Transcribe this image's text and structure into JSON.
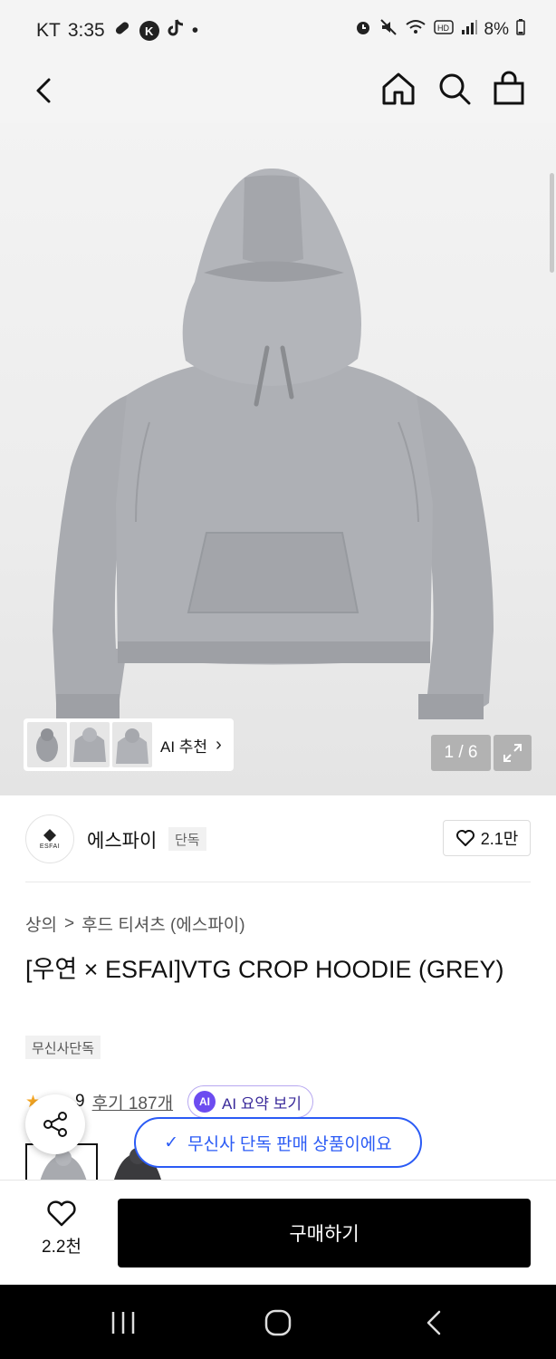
{
  "status_bar": {
    "carrier": "KT",
    "time": "3:35",
    "left_icons": [
      "link-icon",
      "k-app-icon",
      "tiktok-icon",
      "dot-icon"
    ],
    "right_icons": [
      "alarm-icon",
      "mute-icon",
      "wifi-icon",
      "hd-icon",
      "signal-icon"
    ],
    "battery": "8%"
  },
  "header": {
    "icons": [
      "back-arrow-icon",
      "home-icon",
      "search-icon",
      "shopping-bag-icon"
    ]
  },
  "gallery": {
    "ai_recommend_label": "AI 추천",
    "page_counter": "1 / 6",
    "current_page": 1,
    "total_pages": 6
  },
  "brand": {
    "logo_text": "ESFAI",
    "name": "에스파이",
    "badge": "단독",
    "likes": "2.1만"
  },
  "breadcrumb": {
    "category": "상의",
    "separator": ">",
    "subcategory": "후드 티셔츠 (에스파이)"
  },
  "product": {
    "title": "[우연 × ESFAI]VTG CROP HOODIE (GREY)",
    "exclusive_tag": "무신사단독"
  },
  "reviews": {
    "rating_partial": "9",
    "review_link": "후기 187개",
    "ai_chip": "AI",
    "ai_summary_label": "AI 요약 보기"
  },
  "toast": {
    "check": "✓",
    "message": "무신사 단독 판매 상품이에요"
  },
  "bottom": {
    "like_count": "2.2천",
    "buy_label": "구매하기"
  },
  "nav": {
    "icons": [
      "recents-icon",
      "home-circle-icon",
      "back-chevron-icon"
    ]
  },
  "colors": {
    "accent_blue": "#2b5bf5",
    "ai_purple": "#6c4cf0",
    "star": "#f5a623",
    "buy_button": "#000000"
  }
}
